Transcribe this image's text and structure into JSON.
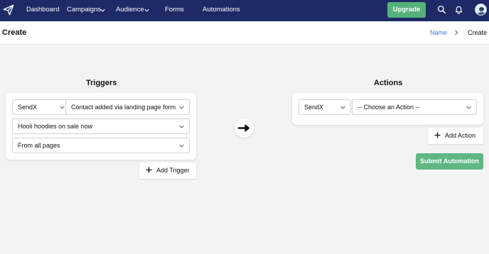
{
  "nav": {
    "items": [
      "Dashboard",
      "Campaigns",
      "Audience",
      "Forms",
      "Automations"
    ],
    "upgrade_label": "Upgrade",
    "logo_icon": "paper-plane-icon",
    "icons": [
      "search-icon",
      "bell-icon",
      "avatar"
    ]
  },
  "header": {
    "title": "Create",
    "breadcrumb_link": "Name",
    "breadcrumb_current": "Create"
  },
  "triggers": {
    "title": "Triggers",
    "app_select": "SendX",
    "event_select": "Contact added via landing page form",
    "form_select": "Hooli hoodies on sale now",
    "pages_select": "From all pages",
    "add_label": "Add Trigger"
  },
  "actions": {
    "title": "Actions",
    "app_select": "SendX",
    "action_select": "-- Choose an Action --",
    "add_label": "Add Action"
  },
  "submit_label": "Submit Automation",
  "colors": {
    "nav_bg": "#1e2a66",
    "upgrade_bg": "#56b27a",
    "submit_bg": "#5fb784",
    "link": "#3b7ddd",
    "page_bg": "#f3f3f4"
  }
}
